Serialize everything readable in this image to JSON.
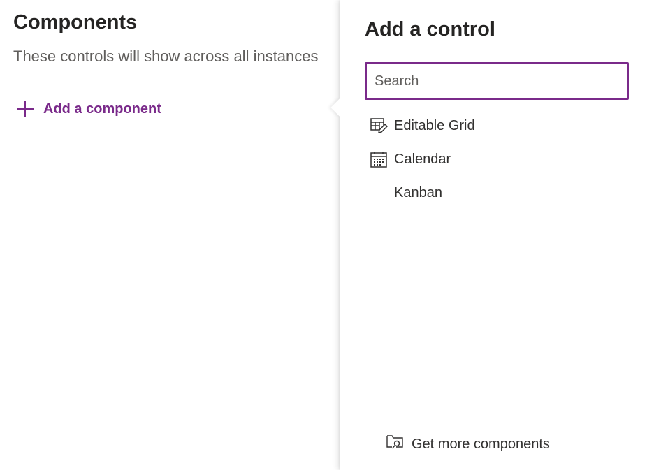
{
  "components_section": {
    "title": "Components",
    "description": "These controls will show across all instances",
    "add_label": "Add a component",
    "add_icon": "plus-icon"
  },
  "flyout": {
    "title": "Add a control",
    "search": {
      "placeholder": "Search",
      "value": ""
    },
    "controls": [
      {
        "label": "Editable Grid",
        "icon": "editable-grid-icon"
      },
      {
        "label": "Calendar",
        "icon": "calendar-icon"
      },
      {
        "label": "Kanban",
        "icon": ""
      }
    ],
    "footer_link": {
      "label": "Get more components",
      "icon": "folder-search-icon"
    }
  },
  "colors": {
    "accent": "#7a2a8a",
    "text": "#323130",
    "muted_text": "#605e5c",
    "divider": "#d2d0ce"
  }
}
